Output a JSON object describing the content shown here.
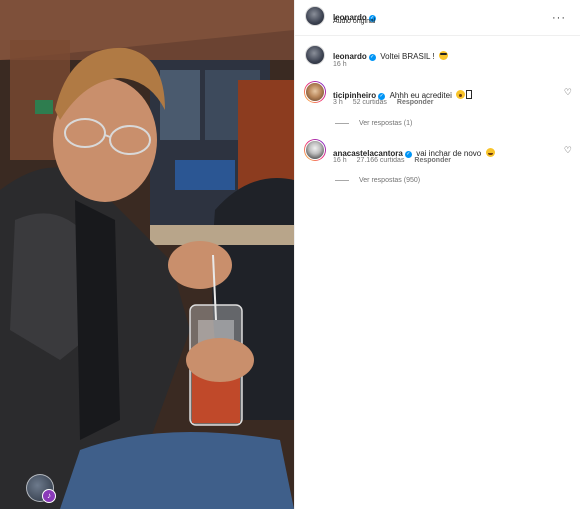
{
  "header": {
    "username": "leonardo",
    "audio_label": "Áudio original",
    "more_icon": "more-horizontal-icon"
  },
  "caption": {
    "username": "leonardo",
    "text": "Voltei BRASIL !",
    "emoji": "smiling-face-with-sunglasses",
    "time": "16 h"
  },
  "comments": [
    {
      "username": "ticipinheiro",
      "text": "Ahhh eu acreditei",
      "emoji": "astonished-face",
      "time": "3 h",
      "likes": "52 curtidas",
      "reply_label": "Responder",
      "view_replies": "Ver respostas (1)"
    },
    {
      "username": "anacastelacantora",
      "text": "vai inchar de novo",
      "emoji": "grinning-squinting-face",
      "time": "16 h",
      "likes": "27.166 curtidas",
      "reply_label": "Responder",
      "view_replies": "Ver respostas (950)"
    }
  ],
  "colors": {
    "verified": "#0095f6",
    "muted_text": "#737373",
    "primary_text": "#262626"
  }
}
